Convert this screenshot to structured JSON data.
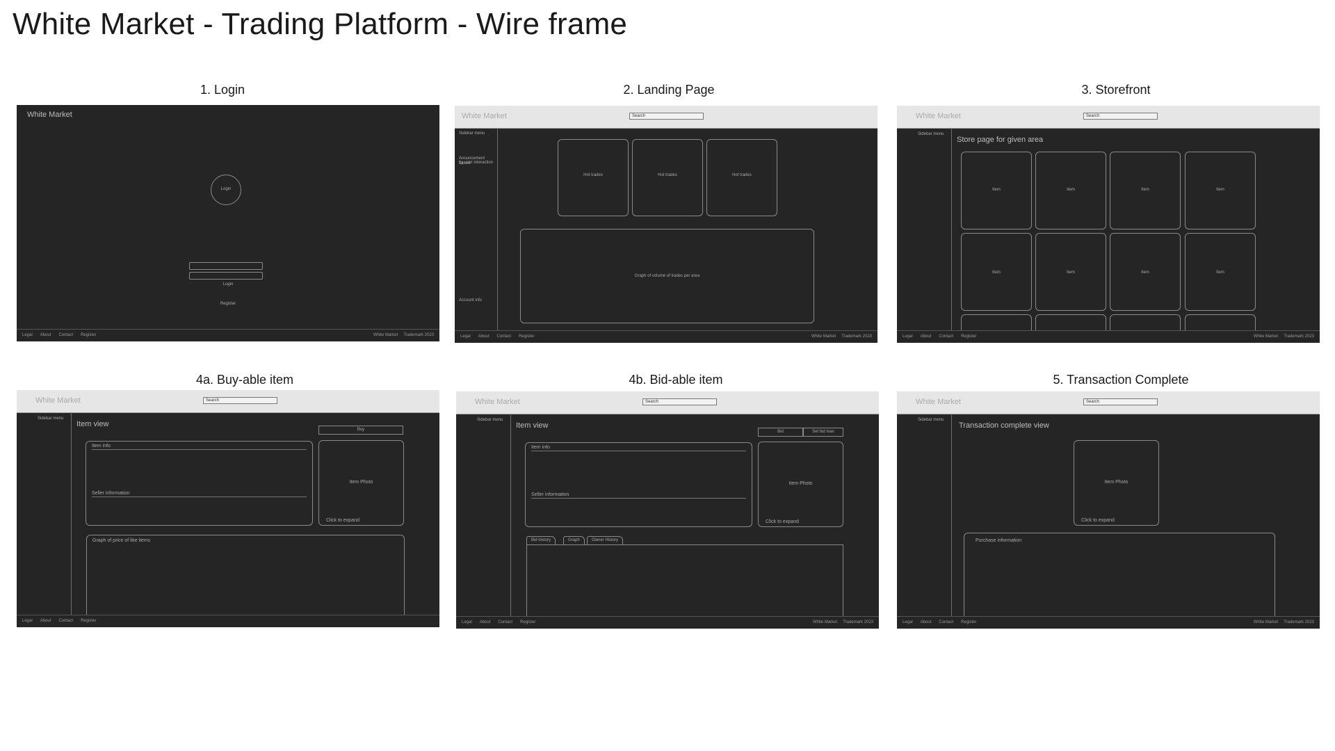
{
  "title": "White Market - Trading Platform - Wire frame",
  "footer": {
    "legal": "Legal",
    "about": "About",
    "contact": "Contact",
    "register": "Register",
    "brand": "White Market",
    "trademark": "Trademark 2023"
  },
  "brand": "White Market",
  "search": "Search",
  "sidebar_menu": "Sidebar menu",
  "panels": {
    "login": {
      "title": "1. Login",
      "circle": "Login",
      "button": "Login",
      "register": "Register"
    },
    "landing": {
      "title": "2. Landing Page",
      "announce1": "Anouncement based",
      "announce2": "by user interaction",
      "account": "Account info",
      "hot_trades": "Hot trades",
      "graph": "Graph of volume of trades per area"
    },
    "storefront": {
      "title": "3. Storefront",
      "heading": "Store page for given area",
      "item": "Item"
    },
    "buyable": {
      "title": "4a. Buy-able item",
      "heading": "Item view",
      "buy": "Buy",
      "item_info": "Item info",
      "seller": "Seller information",
      "photo": "Item Photo",
      "expand": "Click to expand",
      "graph": "Graph of price of like items"
    },
    "bidable": {
      "title": "4b. Bid-able item",
      "heading": "Item view",
      "bid": "Bid",
      "set_bid_max": "Set bid max",
      "item_info": "Item info",
      "seller": "Seller information",
      "photo": "Item Photo",
      "expand": "Click to expand",
      "tab_bid_history": "Bid history",
      "tab_graph": "Graph",
      "tab_owner_history": "Owner History"
    },
    "complete": {
      "title": "5. Transaction Complete",
      "heading": "Transaction complete view",
      "photo": "Item Photo",
      "expand": "Click to expand",
      "purchase": "Purchase information"
    }
  }
}
